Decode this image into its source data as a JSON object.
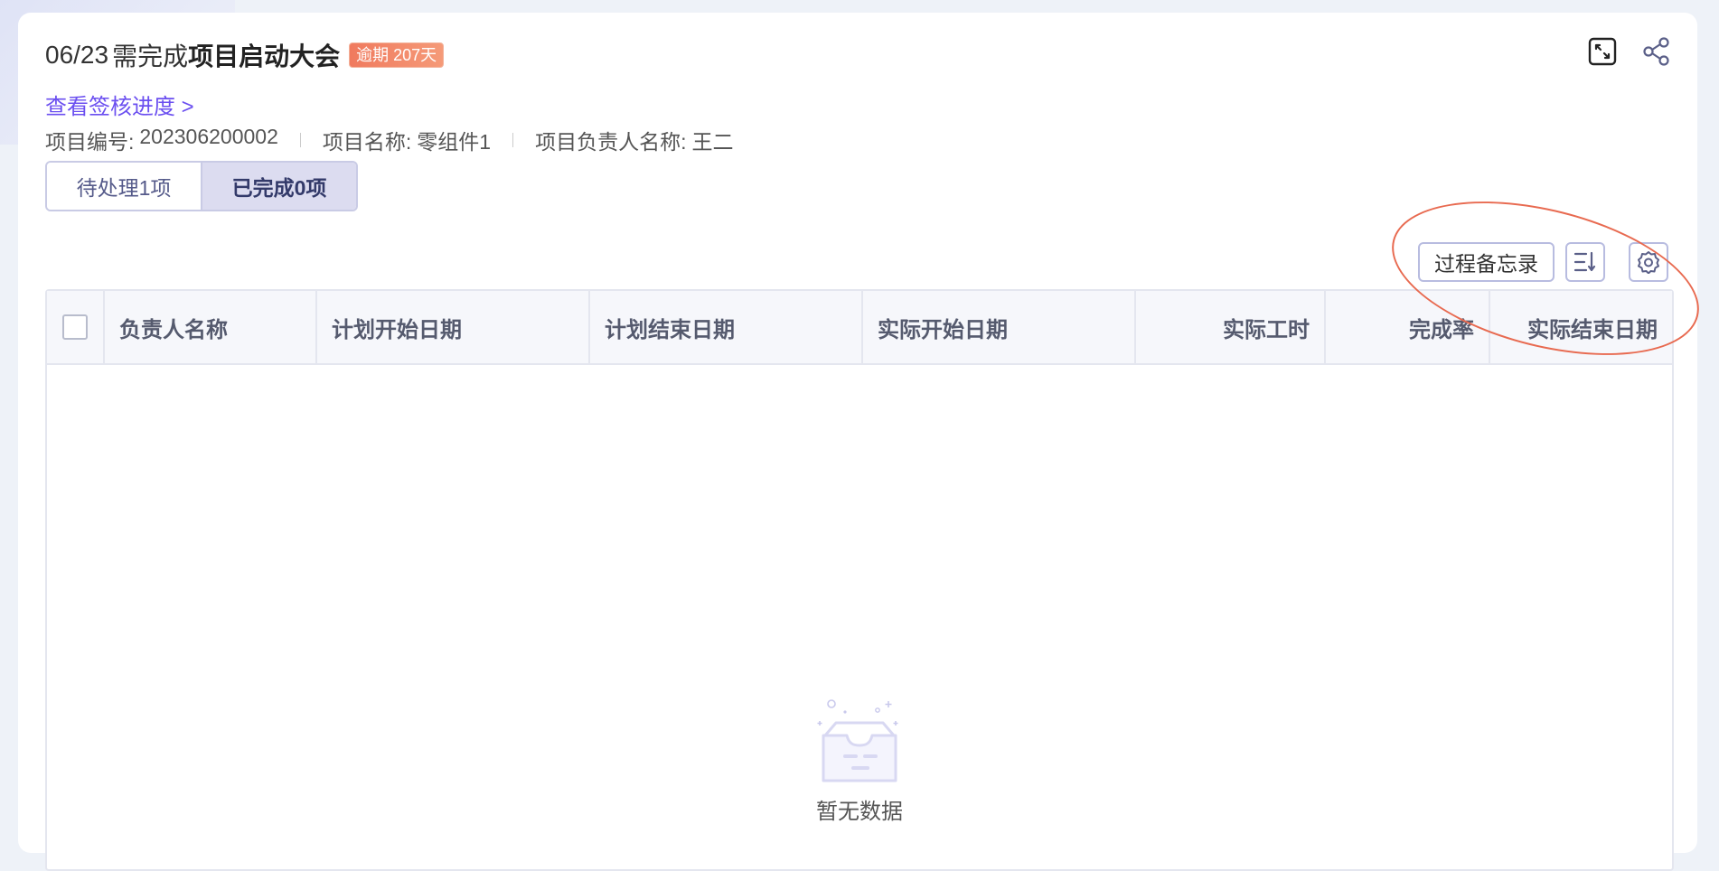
{
  "header": {
    "date": "06/23",
    "need_text": "需完成",
    "task_name": "项目启动大会",
    "overdue_badge": "逾期 207天",
    "progress_link": "查看签核进度 >"
  },
  "meta": {
    "items": [
      {
        "label": "项目编号:",
        "value": "202306200002"
      },
      {
        "label": "项目名称:",
        "value": "零组件1"
      },
      {
        "label": "项目负责人名称:",
        "value": "王二"
      }
    ]
  },
  "tabs": [
    {
      "label": "待处理1项",
      "active": false
    },
    {
      "label": "已完成0项",
      "active": true
    }
  ],
  "toolbar": {
    "memo_label": "过程备忘录",
    "sort_icon": "sort-icon",
    "settings_icon": "gear-icon"
  },
  "table": {
    "columns": [
      "负责人名称",
      "计划开始日期",
      "计划结束日期",
      "实际开始日期",
      "实际工时",
      "完成率",
      "实际结束日期"
    ],
    "rows": [],
    "empty_text": "暂无数据"
  },
  "colors": {
    "accent": "#6b4ff0",
    "overdue": "#f07a5e",
    "annotation": "#e86a50"
  }
}
